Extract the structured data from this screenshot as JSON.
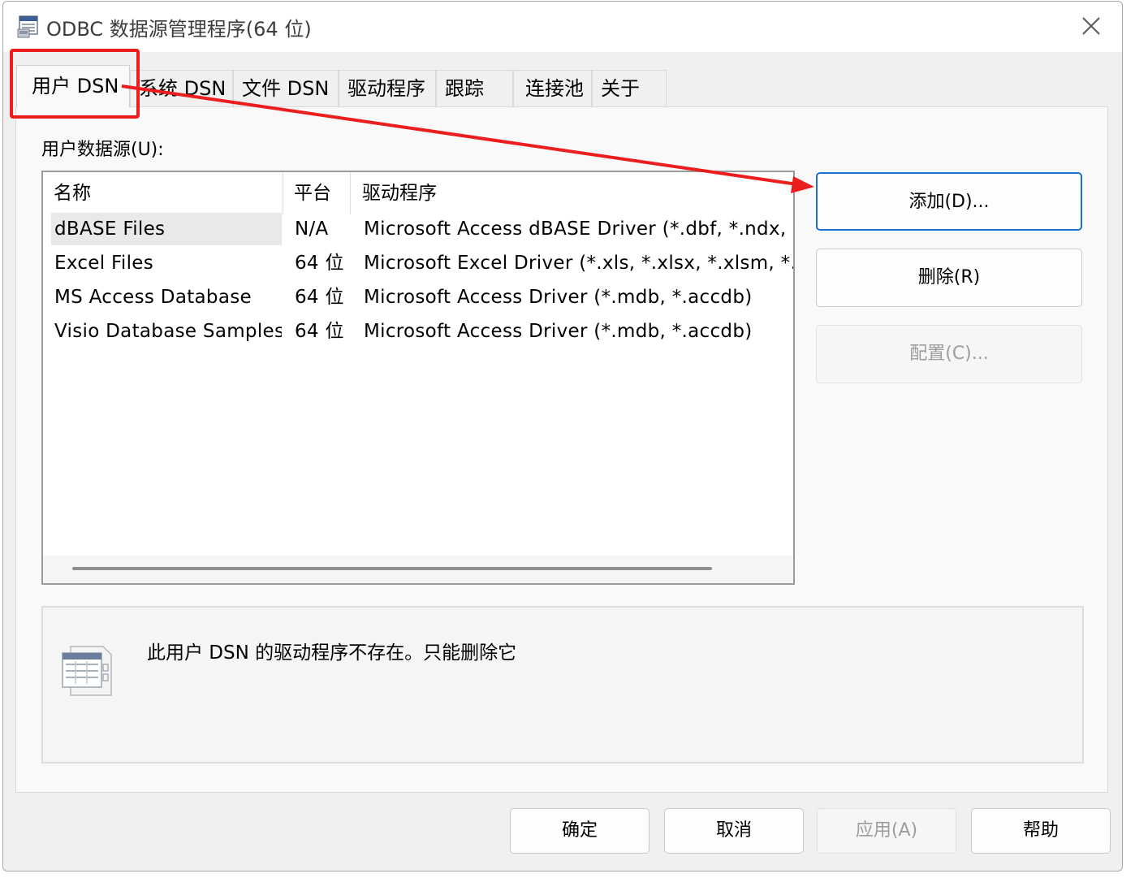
{
  "window": {
    "title": "ODBC 数据源管理程序(64 位)",
    "app_icon": "odbc-app-icon",
    "close_icon": "close-icon"
  },
  "tabs": [
    {
      "label": "用户 DSN",
      "active": true
    },
    {
      "label": "系统 DSN"
    },
    {
      "label": "文件 DSN"
    },
    {
      "label": "驱动程序"
    },
    {
      "label": "跟踪"
    },
    {
      "label": "连接池"
    },
    {
      "label": "关于"
    }
  ],
  "user_dsn": {
    "section_label": "用户数据源(U):",
    "columns": {
      "name": "名称",
      "platform": "平台",
      "driver": "驱动程序"
    },
    "rows": [
      {
        "name": "dBASE Files",
        "platform": "N/A",
        "driver": "Microsoft Access dBASE Driver (*.dbf, *.ndx, *.mdx)",
        "selected": true
      },
      {
        "name": "Excel Files",
        "platform": "64 位",
        "driver": "Microsoft Excel Driver (*.xls, *.xlsx, *.xlsm, *.xlsb)"
      },
      {
        "name": "MS Access Database",
        "platform": "64 位",
        "driver": "Microsoft Access Driver (*.mdb, *.accdb)"
      },
      {
        "name": "Visio Database Samples",
        "platform": "64 位",
        "driver": "Microsoft Access Driver (*.mdb, *.accdb)"
      }
    ],
    "buttons": {
      "add": "添加(D)...",
      "remove": "删除(R)",
      "configure": "配置(C)..."
    },
    "info_icon": "datasource-icon",
    "info_text": "此用户 DSN 的驱动程序不存在。只能删除它"
  },
  "footer": {
    "ok": "确定",
    "cancel": "取消",
    "apply": "应用(A)",
    "help": "帮助"
  },
  "annotation": {
    "color": "#ec1d1d"
  },
  "colors": {
    "primary_border": "#1f6fd1",
    "disabled_text": "#9d9d9d"
  }
}
